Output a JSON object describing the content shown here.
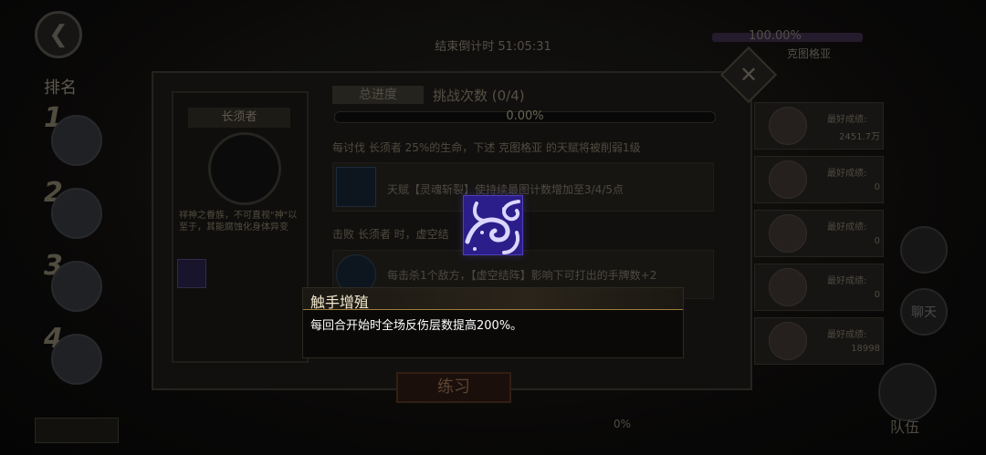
{
  "header": {
    "title": "",
    "countdown": "结束倒计时 51:05:31",
    "boss_progress": "100.00%",
    "boss_name": "克图格亚"
  },
  "ranking": {
    "title": "排名",
    "ranks": [
      "1",
      "2",
      "3",
      "4"
    ]
  },
  "dialog": {
    "boss_name": "长须者",
    "boss_desc": "祥神之眷族，不可直视\"神\"以至于，其能腐蚀化身体异变",
    "tab_total": "总进度",
    "challenge_count": "挑战次数 (0/4)",
    "progress_text": "0.00%",
    "condition_1": "每讨伐 长须者 25%的生命，下述 克图格亚 的天赋将被削弱1级",
    "condition_1_detail": "天赋【灵魂斩裂】使持续最图计数增加至3/4/5点",
    "condition_2": "击败 长须者 时，虚空结",
    "condition_2_detail": "每击杀1个敌方，【虚空结阵】影响下可打出的手牌数+2",
    "practice_label": "练习",
    "close_symbol": "✕"
  },
  "records": [
    {
      "label": "最好成绩:",
      "value": "2451.7万"
    },
    {
      "label": "最好成绩:",
      "value": "0"
    },
    {
      "label": "最好成绩:",
      "value": "0"
    },
    {
      "label": "最好成绩:",
      "value": "0"
    },
    {
      "label": "最好成绩:",
      "value": "18998"
    }
  ],
  "side": {
    "chat_label": "聊天",
    "team_label": "队伍",
    "bottom_pct": "0%"
  },
  "tooltip": {
    "title": "触手增殖",
    "body": "每回合开始时全场反伤层数提高200%。"
  },
  "colors": {
    "tooltip_border": "#a07a3c",
    "skill_icon_bg": "#2b1e8a",
    "title_text": "#f3e9cf"
  },
  "icons": {
    "skill": "tentacle-icon",
    "close": "close-icon",
    "back": "back-arrow-icon"
  }
}
